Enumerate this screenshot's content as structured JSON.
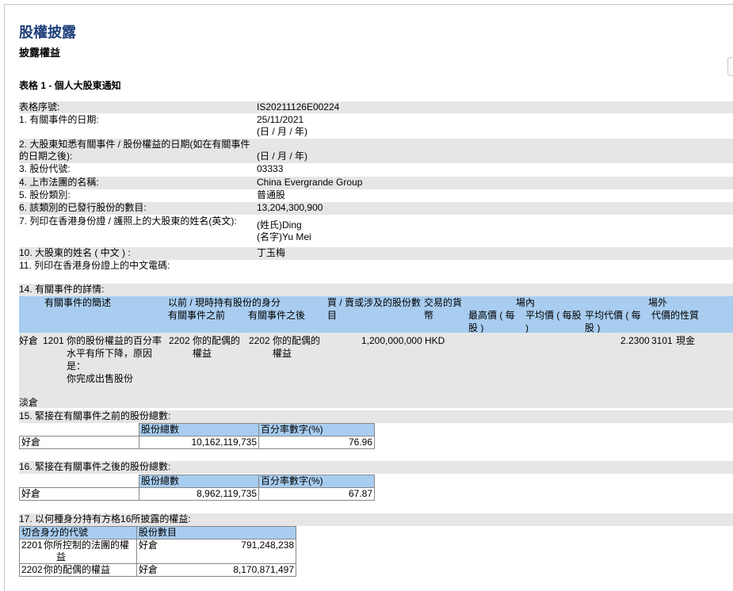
{
  "page": {
    "title": "股權披露",
    "subtitle": "披露權益",
    "form_title": "表格 1 - 個人大股東通知"
  },
  "fields": [
    {
      "label": "表格序號:",
      "value": "IS20211126E00224"
    },
    {
      "label": "1. 有關事件的日期:",
      "value": "25/11/2021",
      "value2": "(日 / 月 / 年)"
    },
    {
      "label": "2. 大股東知悉有關事件 / 股份權益的日期(如在有關事件",
      "label2": "的日期之後):",
      "value": "(日 / 月 / 年)"
    },
    {
      "label": "3. 股份代號:",
      "value": "03333"
    },
    {
      "label": "4. 上市法團的名稱:",
      "value": "China Evergrande Group"
    },
    {
      "label": "5. 股份類別:",
      "value": "普通股"
    },
    {
      "label": "6. 該類別的已發行股份的數目:",
      "value": "13,204,300,900"
    },
    {
      "label": "7. 列印在香港身份證 / 護照上的大股東的姓名(英文):",
      "value": "(姓氏)Ding",
      "value2": "(名字)Yu Mei"
    },
    {
      "label": "10. 大股東的姓名 ( 中文 ) :",
      "value": "丁玉梅"
    },
    {
      "label": "11. 列印在香港身份證上的中文電碼:",
      "value": ""
    }
  ],
  "section14": {
    "title": "14. 有關事件的詳情:",
    "headers": {
      "event_desc": "有關事件的簡述",
      "capacity": "以前 / 現時持有股份的身分",
      "before": "有關事件之前",
      "after": "有關事件之後",
      "shares": "買 / 賣或涉及的股份數目",
      "currency": "交易的貨幣",
      "onexch": "場內",
      "high": "最高價 ( 每股 )",
      "avg": "平均價 ( 每股 )",
      "offexch": "場外",
      "avg_off": "平均代價 ( 每股 )",
      "nature": "代價的性質"
    },
    "row": {
      "position": "好倉",
      "code": "1201",
      "desc": [
        "你的股份權益的百分率",
        "水平有所下降，原因",
        "是：",
        "你完成出售股份"
      ],
      "before_code": "2202",
      "before_text": [
        "你的配偶的",
        "權益"
      ],
      "after_code": "2202",
      "after_text": [
        "你的配偶的",
        "權益"
      ],
      "shares": "1,200,000,000",
      "currency": "HKD",
      "avg_off": "2.2300",
      "nature_code": "3101",
      "nature": "現金"
    },
    "footer": "淡倉"
  },
  "section15": {
    "title": "15. 緊接在有關事件之前的股份總數:",
    "col1": "股份總數",
    "col2": "百分率數字(%)",
    "row_label": "好倉",
    "shares": "10,162,119,735",
    "pct": "76.96"
  },
  "section16": {
    "title": "16. 緊接在有關事件之後的股份總數:",
    "col1": "股份總數",
    "col2": "百分率數字(%)",
    "row_label": "好倉",
    "shares": "8,962,119,735",
    "pct": "67.87"
  },
  "section17": {
    "title": "17. 以何種身分持有方格16所披露的權益:",
    "col1": "切合身分的代號",
    "col2": "股份數目",
    "rows": [
      {
        "code": "2201",
        "desc1": "你所控制的法團的權",
        "desc2": "益",
        "pos": "好倉",
        "shares": "791,248,238"
      },
      {
        "code": "2202",
        "desc1": "你的配偶的權益",
        "desc2": "",
        "pos": "好倉",
        "shares": "8,170,871,497"
      }
    ]
  }
}
